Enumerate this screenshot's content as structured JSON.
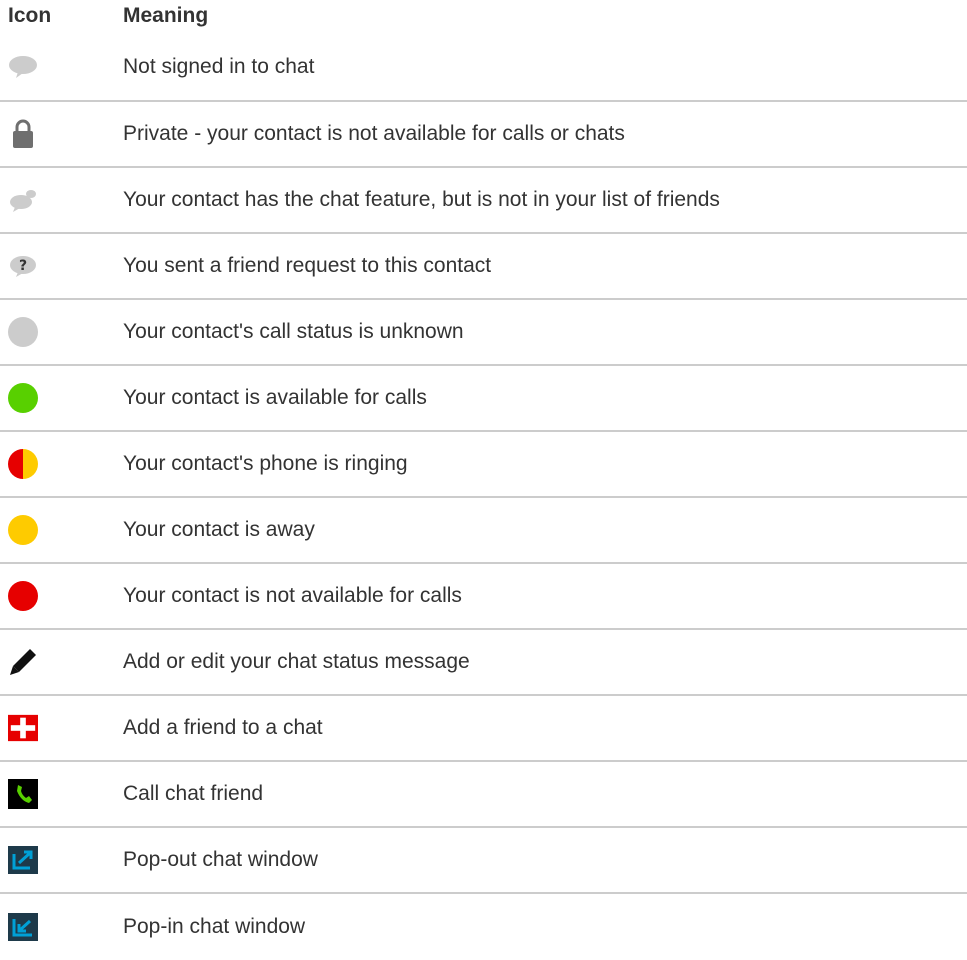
{
  "header": {
    "icon_col": "Icon",
    "meaning_col": "Meaning"
  },
  "rows": [
    {
      "icon": "chat-bubble-gray-icon",
      "meaning": "Not signed in to chat"
    },
    {
      "icon": "padlock-icon",
      "meaning": "Private - your contact is not available for calls or chats"
    },
    {
      "icon": "chat-bubble-small-gray-icon",
      "meaning": "Your contact has the chat feature, but is not in your list of friends"
    },
    {
      "icon": "chat-bubble-question-icon",
      "meaning": "You sent a friend request to this contact"
    },
    {
      "icon": "status-unknown-dot-icon",
      "meaning": "Your contact's call status is unknown"
    },
    {
      "icon": "status-available-dot-icon",
      "meaning": "Your contact is available for calls"
    },
    {
      "icon": "status-ringing-dot-icon",
      "meaning": "Your contact's phone is ringing"
    },
    {
      "icon": "status-away-dot-icon",
      "meaning": "Your contact is away"
    },
    {
      "icon": "status-unavailable-dot-icon",
      "meaning": "Your contact is not available for calls"
    },
    {
      "icon": "pencil-icon",
      "meaning": "Add or edit your chat status message"
    },
    {
      "icon": "add-friend-plus-icon",
      "meaning": "Add a friend to a chat"
    },
    {
      "icon": "phone-call-icon",
      "meaning": "Call chat friend"
    },
    {
      "icon": "pop-out-icon",
      "meaning": "Pop-out chat window"
    },
    {
      "icon": "pop-in-icon",
      "meaning": "Pop-in chat window"
    }
  ],
  "colors": {
    "gray": "#cccccc",
    "dark_gray": "#6f6f6f",
    "green": "#58d000",
    "red": "#e60000",
    "yellow": "#fecb00",
    "blue": "#00a0d6",
    "black": "#000000"
  }
}
